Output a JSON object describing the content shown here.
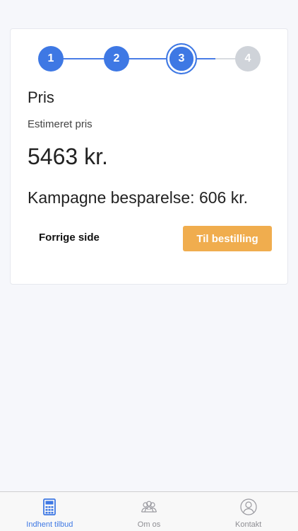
{
  "stepper": {
    "steps": [
      {
        "label": "1",
        "state": "done"
      },
      {
        "label": "2",
        "state": "done"
      },
      {
        "label": "3",
        "state": "current"
      },
      {
        "label": "4",
        "state": "todo"
      }
    ]
  },
  "content": {
    "title": "Pris",
    "subtitle": "Estimeret pris",
    "price": "5463 kr.",
    "savings": "Kampagne besparelse: 606 kr."
  },
  "actions": {
    "prev_label": "Forrige side",
    "next_label": "Til bestilling"
  },
  "tabbar": {
    "tabs": [
      {
        "label": "Indhent tilbud",
        "icon": "calculator-icon",
        "active": true
      },
      {
        "label": "Om os",
        "icon": "group-icon",
        "active": false
      },
      {
        "label": "Kontakt",
        "icon": "person-icon",
        "active": false
      }
    ]
  },
  "colors": {
    "accent": "#3e78e4",
    "cta": "#f0ad4e",
    "inactive_step": "#cfd3d9"
  }
}
